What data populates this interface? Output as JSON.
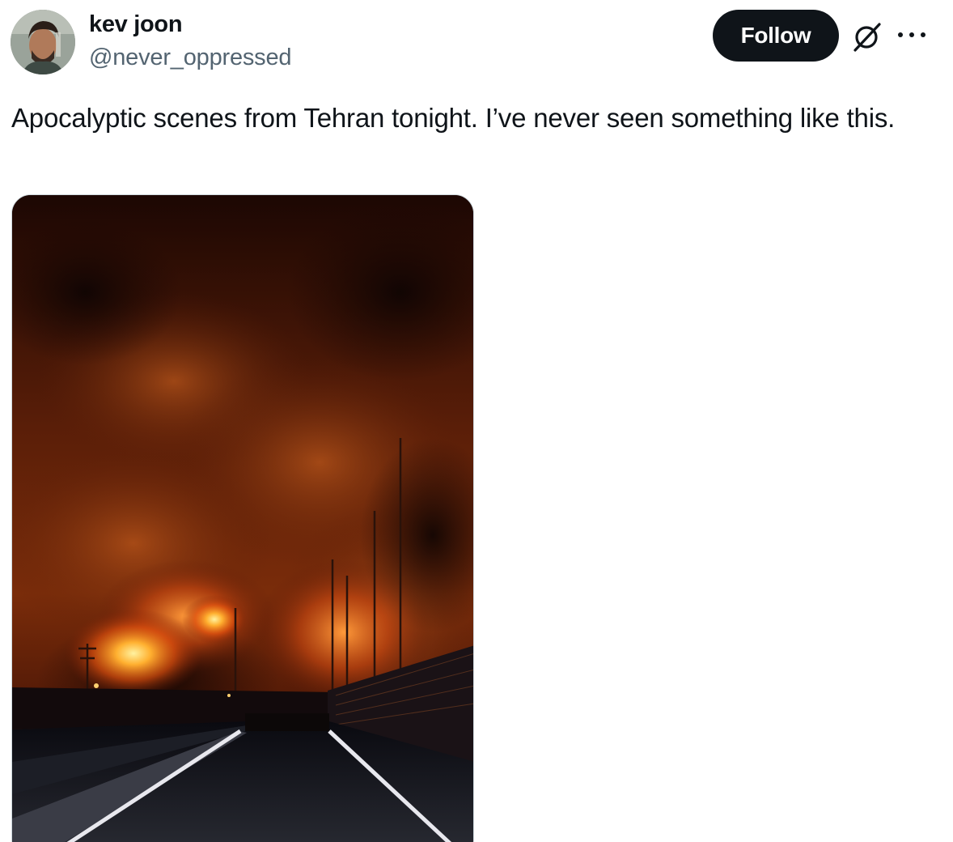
{
  "author": {
    "display_name": "kev joon",
    "handle": "@never_oppressed",
    "avatar_icon": "profile-photo"
  },
  "actions": {
    "follow_label": "Follow",
    "grok_icon": "grok-icon",
    "more_icon": "more-icon"
  },
  "tweet": {
    "text": "Apocalyptic scenes from Tehran tonight. I’ve never seen something like this."
  },
  "colors": {
    "text_primary": "#0f1419",
    "text_secondary": "#536471",
    "button_bg": "#0f1419",
    "border": "#cfd9de"
  }
}
